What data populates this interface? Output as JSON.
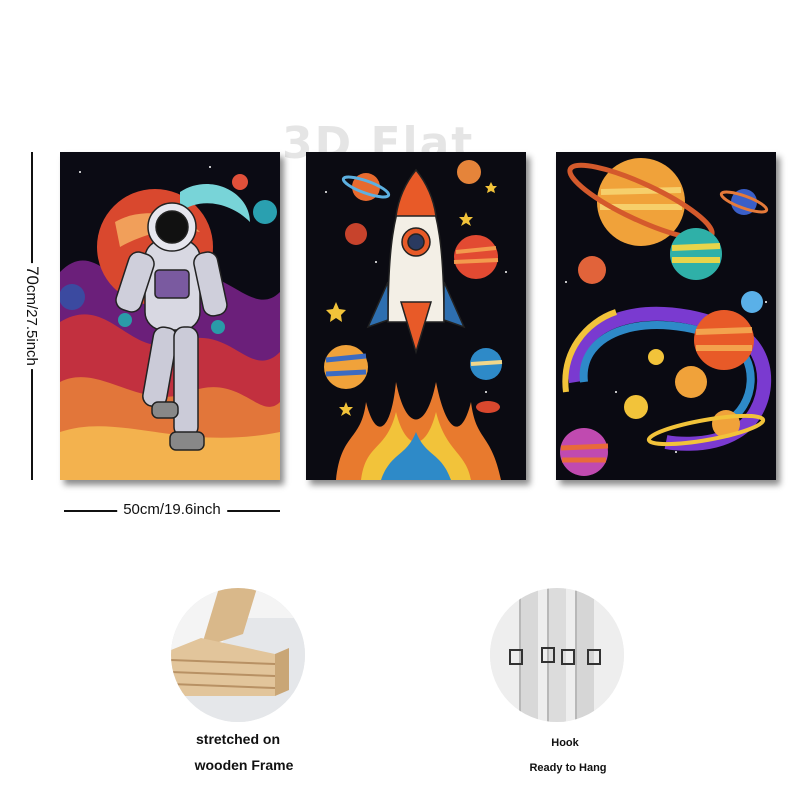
{
  "watermark": "3D Flat",
  "dimensions": {
    "height_label": "70",
    "height_rest": "cm/27.5inch",
    "width_label": "50cm/19.6inch"
  },
  "panels": [
    {
      "subject": "astronaut-walking"
    },
    {
      "subject": "rocket-launch"
    },
    {
      "subject": "planets-orbit"
    }
  ],
  "features": [
    {
      "line1": "stretched on",
      "line2": "wooden Frame"
    },
    {
      "line1": "Hook",
      "line2": "Ready to Hang"
    }
  ]
}
